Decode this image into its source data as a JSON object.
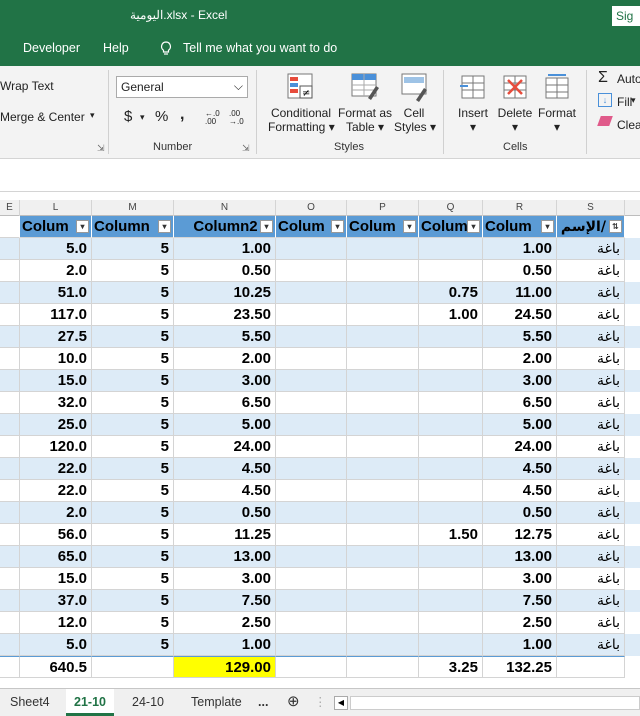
{
  "window": {
    "title": "اليومية.xlsx  -  Excel",
    "signin": "Sig"
  },
  "menu": {
    "developer": "Developer",
    "help": "Help",
    "tell_me": "Tell me what you want to do"
  },
  "ribbon": {
    "wrap_text": "Wrap Text",
    "merge_center": "Merge & Center",
    "number_format": "General",
    "currency": "$",
    "percent": "%",
    "comma": ",",
    "inc_decimal": "←.0 .00",
    "dec_decimal": ".00 →.0",
    "number_group": "Number",
    "conditional_formatting": [
      "Conditional",
      "Formatting"
    ],
    "format_as_table": [
      "Format as",
      "Table"
    ],
    "cell_styles": [
      "Cell",
      "Styles"
    ],
    "styles_group": "Styles",
    "insert": "Insert",
    "delete": "Delete",
    "format": "Format",
    "cells_group": "Cells",
    "autosum": "Auto",
    "fill": "Fill",
    "clear": "Clea"
  },
  "columns": [
    "E",
    "L",
    "M",
    "N",
    "O",
    "P",
    "Q",
    "R",
    "S"
  ],
  "headers": [
    "Colum",
    "Column",
    "Column2",
    "Colum",
    "Colum",
    "Colum",
    "Colum",
    "الإسم/"
  ],
  "rows": [
    [
      "5.0",
      "5",
      "1.00",
      "",
      "",
      "",
      "1.00",
      "باغة"
    ],
    [
      "2.0",
      "5",
      "0.50",
      "",
      "",
      "",
      "0.50",
      "باغة"
    ],
    [
      "51.0",
      "5",
      "10.25",
      "",
      "",
      "0.75",
      "11.00",
      "باغة"
    ],
    [
      "117.0",
      "5",
      "23.50",
      "",
      "",
      "1.00",
      "24.50",
      "باغة"
    ],
    [
      "27.5",
      "5",
      "5.50",
      "",
      "",
      "",
      "5.50",
      "باغة"
    ],
    [
      "10.0",
      "5",
      "2.00",
      "",
      "",
      "",
      "2.00",
      "باغة"
    ],
    [
      "15.0",
      "5",
      "3.00",
      "",
      "",
      "",
      "3.00",
      "باغة"
    ],
    [
      "32.0",
      "5",
      "6.50",
      "",
      "",
      "",
      "6.50",
      "باغة"
    ],
    [
      "25.0",
      "5",
      "5.00",
      "",
      "",
      "",
      "5.00",
      "باغة"
    ],
    [
      "120.0",
      "5",
      "24.00",
      "",
      "",
      "",
      "24.00",
      "باغة"
    ],
    [
      "22.0",
      "5",
      "4.50",
      "",
      "",
      "",
      "4.50",
      "باغة"
    ],
    [
      "22.0",
      "5",
      "4.50",
      "",
      "",
      "",
      "4.50",
      "باغة"
    ],
    [
      "2.0",
      "5",
      "0.50",
      "",
      "",
      "",
      "0.50",
      "باغة"
    ],
    [
      "56.0",
      "5",
      "11.25",
      "",
      "",
      "1.50",
      "12.75",
      "باغة"
    ],
    [
      "65.0",
      "5",
      "13.00",
      "",
      "",
      "",
      "13.00",
      "باغة"
    ],
    [
      "15.0",
      "5",
      "3.00",
      "",
      "",
      "",
      "3.00",
      "باغة"
    ],
    [
      "37.0",
      "5",
      "7.50",
      "",
      "",
      "",
      "7.50",
      "باغة"
    ],
    [
      "12.0",
      "5",
      "2.50",
      "",
      "",
      "",
      "2.50",
      "باغة"
    ],
    [
      "5.0",
      "5",
      "1.00",
      "",
      "",
      "",
      "1.00",
      "باغة"
    ]
  ],
  "totals": [
    "640.5",
    "",
    "129.00",
    "",
    "",
    "3.25",
    "132.25",
    ""
  ],
  "sheets": [
    "Sheet4",
    "21-10",
    "24-10",
    "Template",
    "..."
  ],
  "active_sheet": "21-10",
  "colors": {
    "excel_green": "#217346",
    "table_header": "#5b9bd5",
    "band": "#ddebf7",
    "highlight": "#ffff00"
  }
}
